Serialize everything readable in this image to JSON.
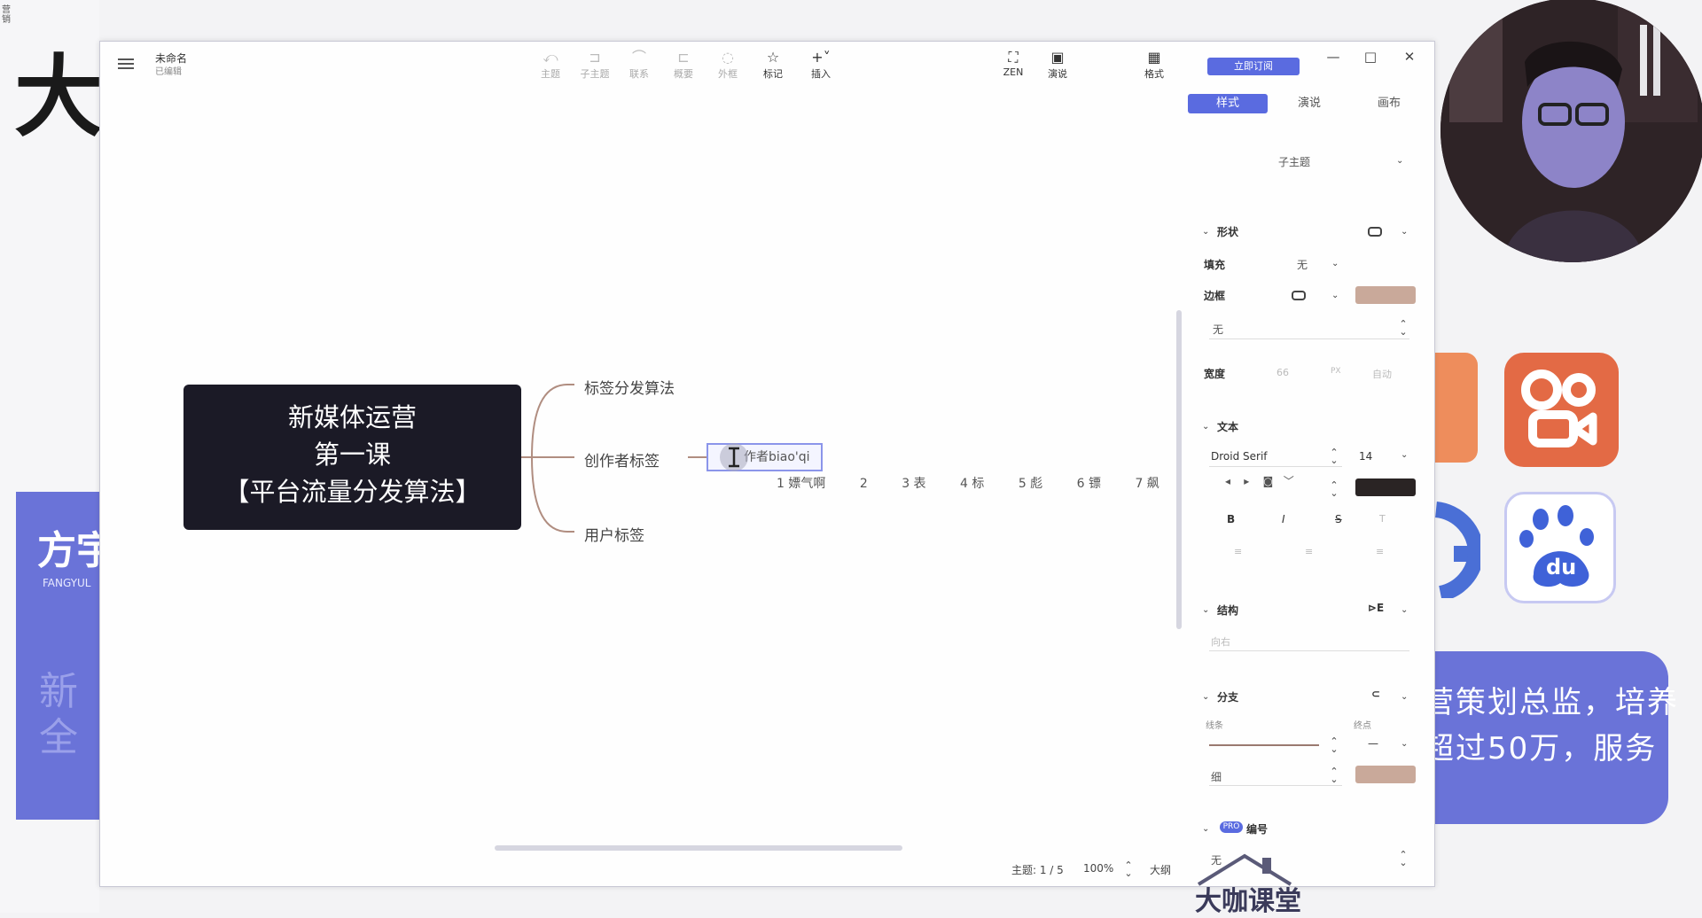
{
  "slide": {
    "left_tiny_text": "营销",
    "big_char": "大",
    "brand_name": "方宇",
    "brand_sub": "FANGYUL",
    "faint_text": "新全",
    "bubble_line1": "营策划总监，培养",
    "bubble_line2": "超过50万，服务",
    "baidu_text": "du",
    "colors": {
      "accent_blue": "#6a73d8",
      "kuaishou": "#e36a45"
    }
  },
  "window": {
    "title": "未命名",
    "subtitle": "已编辑",
    "toolbar": {
      "topic": "主题",
      "subtopic": "子主题",
      "relation": "联系",
      "summary": "概要",
      "boundary": "外框",
      "marker": "标记",
      "insert": "插入",
      "zen": "ZEN",
      "present": "演说",
      "format": "格式",
      "subscribe": "立即订阅"
    },
    "controls": {
      "minimize": "—",
      "maximize": "□",
      "close": "✕"
    }
  },
  "canvas": {
    "root_lines": [
      "新媒体运营",
      "第一课",
      "【平台流量分发算法】"
    ],
    "children": [
      "标签分发算法",
      "创作者标签",
      "用户标签"
    ],
    "editing_text": "作者biao'qi",
    "ime_candidates": [
      "1 嫖气啊",
      "2",
      "3 表",
      "4 标",
      "5 彪",
      "6 镖",
      "7 飙"
    ]
  },
  "status_bar": {
    "topics": "主题: 1 / 5",
    "zoom": "100%",
    "outline": "大纲"
  },
  "panel": {
    "tabs": [
      "样式",
      "演说",
      "画布"
    ],
    "style_select": "子主题",
    "shape_label": "形状",
    "fill_label": "填充",
    "fill_value": "无",
    "border_label": "边框",
    "border_style": "无",
    "width_label": "宽度",
    "width_value": "66",
    "width_unit": "PX",
    "width_auto": "自动",
    "text_label": "文本",
    "font_family": "Droid Serif",
    "font_size": "14",
    "bold": "B",
    "italic": "I",
    "strike": "S",
    "case": "T",
    "structure_label": "结构",
    "structure_value": "向右",
    "branch_label": "分支",
    "line_label": "线条",
    "end_label": "终点",
    "line_weight": "细",
    "numbering_label": "编号",
    "numbering_value": "无",
    "pro": "PRO",
    "colors": {
      "border_swatch": "#c9a99a",
      "text_swatch": "#2a2424",
      "branch_swatch": "#c9a99a",
      "tab_active": "#5a6be0"
    }
  },
  "watermark": "大咖课堂"
}
